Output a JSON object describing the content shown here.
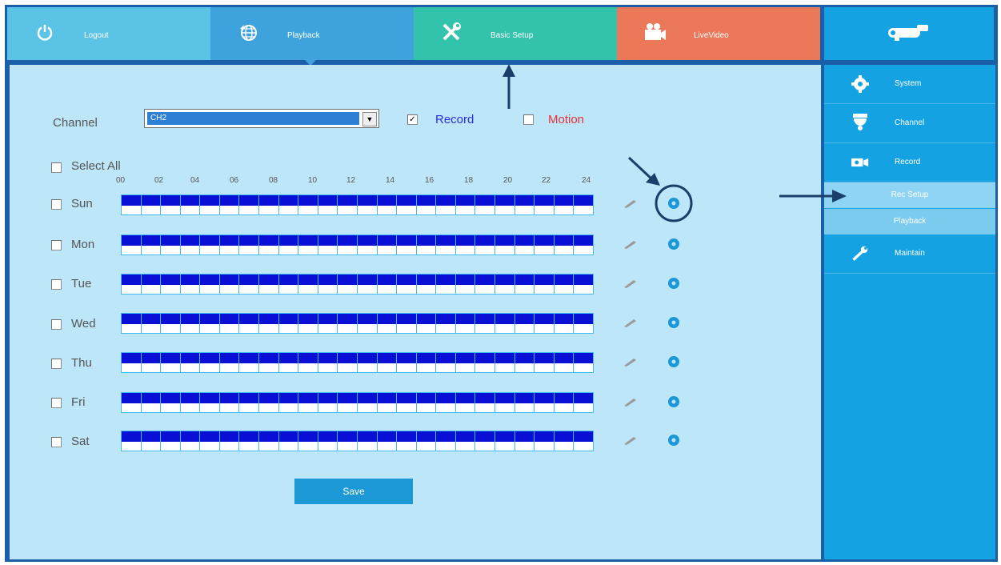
{
  "top_tabs": [
    {
      "label": "Logout",
      "icon": "power-icon"
    },
    {
      "label": "Playback",
      "icon": "globe-icon"
    },
    {
      "label": "Basic Setup",
      "icon": "tools-icon"
    },
    {
      "label": "LiveVideo",
      "icon": "camera-icon"
    }
  ],
  "brand": {
    "icon": "camera-logo-icon"
  },
  "sidebar": {
    "items": [
      {
        "label": "System",
        "icon": "gear-icon"
      },
      {
        "label": "Channel",
        "icon": "dome-camera-icon"
      },
      {
        "label": "Record",
        "icon": "record-icon"
      }
    ],
    "subitems": [
      {
        "label": "Rec Setup",
        "active": true
      },
      {
        "label": "Playback",
        "active": false
      }
    ],
    "maintain": {
      "label": "Maintain",
      "icon": "wrench-icon"
    }
  },
  "form": {
    "channel_label": "Channel",
    "channel_value": "CH2",
    "record_label": "Record",
    "record_checked": true,
    "motion_label": "Motion",
    "motion_checked": false,
    "select_all_label": "Select All",
    "hours": [
      "00",
      "02",
      "04",
      "06",
      "08",
      "10",
      "12",
      "14",
      "16",
      "18",
      "20",
      "22",
      "24"
    ],
    "days": [
      {
        "label": "Sun",
        "checked": false
      },
      {
        "label": "Mon",
        "checked": false
      },
      {
        "label": "Tue",
        "checked": false
      },
      {
        "label": "Wed",
        "checked": false
      },
      {
        "label": "Thu",
        "checked": false
      },
      {
        "label": "Fri",
        "checked": false
      },
      {
        "label": "Sat",
        "checked": false
      }
    ],
    "save_label": "Save"
  },
  "colors": {
    "schedule_fill": "#0a0fd6",
    "record_text": "#2b2be0",
    "motion_text": "#e8323c"
  }
}
